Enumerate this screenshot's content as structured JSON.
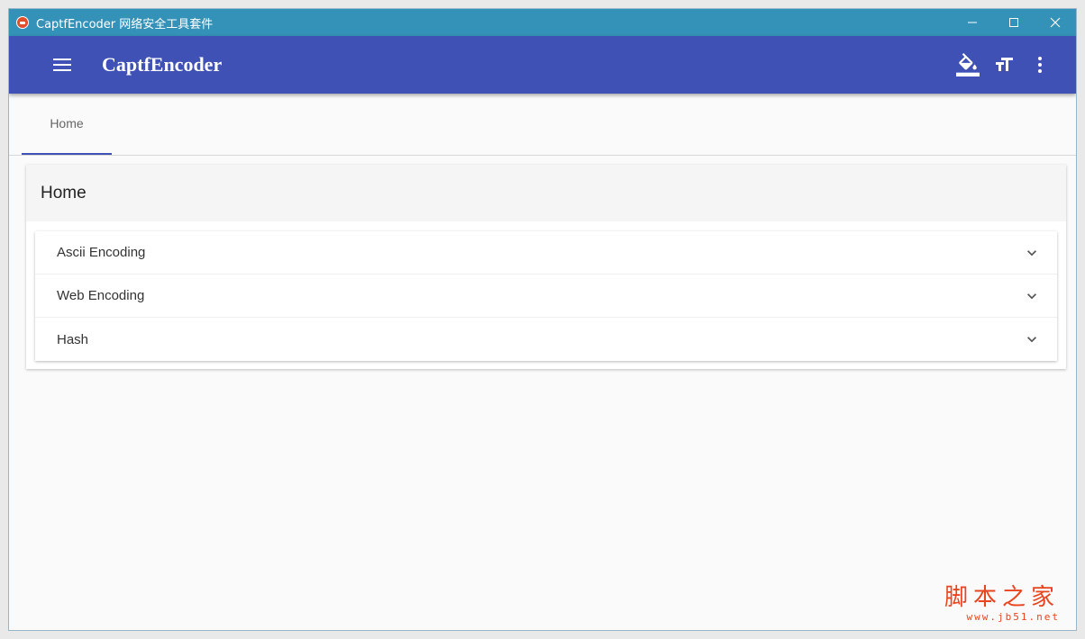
{
  "window": {
    "title": "CaptfEncoder 网络安全工具套件",
    "controls": {
      "minimize": "—",
      "maximize": "☐",
      "close": "✕"
    }
  },
  "appbar": {
    "title": "CaptfEncoder",
    "icons": [
      "menu-icon",
      "format-color-fill-icon",
      "format-size-icon",
      "more-vert-icon"
    ]
  },
  "tabs": [
    {
      "label": "Home",
      "active": true
    }
  ],
  "card": {
    "title": "Home",
    "items": [
      {
        "label": "Ascii Encoding"
      },
      {
        "label": "Web Encoding"
      },
      {
        "label": "Hash"
      }
    ]
  },
  "watermark": {
    "text": "脚本之家",
    "url": "www.jb51.net"
  },
  "colors": {
    "titlebar": "#3492b8",
    "appbar": "#3f51b5",
    "accent": "#3f51b5",
    "watermark": "#e8451e"
  }
}
